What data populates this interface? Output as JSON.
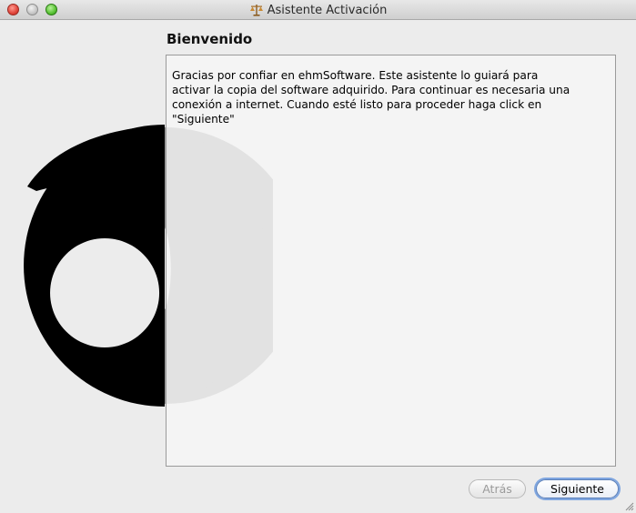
{
  "window": {
    "title": "Asistente Activación"
  },
  "main": {
    "heading": "Bienvenido",
    "body": "Gracias por confiar en ehmSoftware. Este asistente lo guiará para\nactivar la copia del software adquirido. Para continuar es necesaria una\nconexión a internet. Cuando esté listo para proceder haga click en\n\"Siguiente\""
  },
  "buttons": {
    "back_label": "Atrás",
    "next_label": "Siguiente"
  },
  "icons": {
    "app": "scales-icon",
    "logo": "swirl-logo"
  },
  "colors": {
    "focus_ring": "#7fa6e0",
    "logo_dark": "#000000",
    "logo_light": "#999999"
  }
}
